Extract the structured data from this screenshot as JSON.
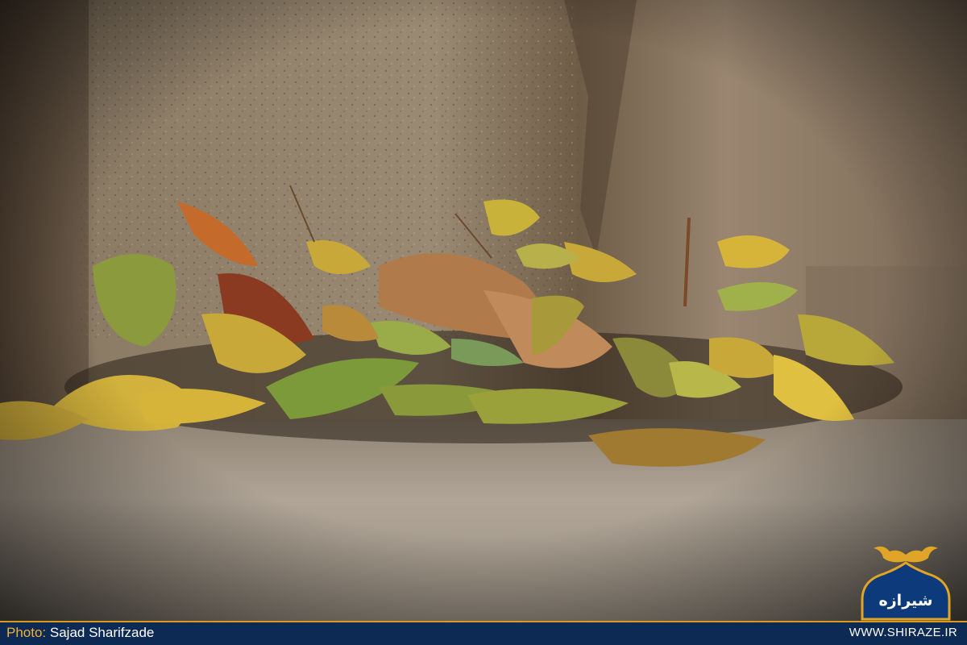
{
  "photo": {
    "subject": "fallen-autumn-leaves-against-stone-wall",
    "palette": {
      "wall": "#8a7a63",
      "wall_dark": "#4a3c2d",
      "ground": "#a69a8a",
      "leaf_yellow": "#d6b43a",
      "leaf_brown": "#a0602e",
      "leaf_green": "#7a8a3a",
      "vignette": "#000000"
    }
  },
  "footer": {
    "credit_label": "Photo:",
    "credit_name": " Sajad Sharifzade",
    "website": "WWW.SHIRAZE.IR",
    "bar_color": "#0d2a55",
    "accent_color": "#d99a1e"
  },
  "logo": {
    "text": "شیرازه",
    "icon": "shiraze-ornament-logo"
  }
}
